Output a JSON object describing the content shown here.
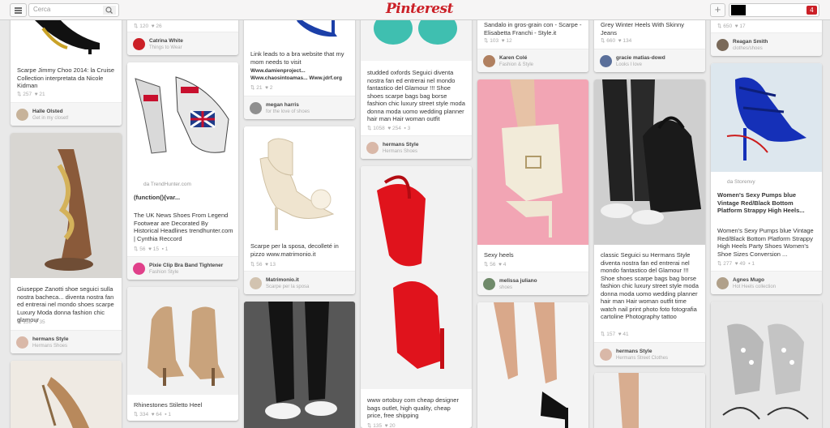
{
  "header": {
    "search_placeholder": "Cerca",
    "logo": "Pinterest",
    "notifications_count": "4",
    "plus_label": "+"
  },
  "pins": {
    "c1p1": {
      "text": "Scarpe Jimmy Choo 2014: la Cruise Collection interpretata da Nicole Kidman",
      "repins": "257",
      "likes": "21",
      "user": "Halle Olsted",
      "board": "Get in my closet!"
    },
    "c1p2": {
      "text": "Giuseppe Zanotti shoe seguici sulla nostra bacheca... diventa nostra fan ed entrerai nel mondo shoes scarpe Luxury Moda donna fashion chic glamour",
      "repins": "158",
      "likes": "35",
      "user": "hermans Style",
      "board": "Hermans Shoes"
    },
    "c2p1": {
      "repins": "120",
      "likes": "26",
      "user": "Catrina White",
      "board": "Things to Wear"
    },
    "c2p2": {
      "source": "da TrendHunter.com",
      "title": "(function(){var...",
      "text": "The UK News Shoes From Legend Footwear are Decorated By Historical Headlines trendhunter.com | Cynthia Reccord",
      "repins": "56",
      "likes": "15",
      "comments": "1",
      "user": "Pixie Clip Bra Band Tightener",
      "board": "Fashion Style"
    },
    "c2p3": {
      "text": "Rhinestones Stiletto Heel",
      "repins": "334",
      "likes": "64",
      "comments": "1"
    },
    "c3p1": {
      "text": "Link leads to a bra website that my mom needs to visit",
      "links": "Www.damienproject... Www.chaosintoamas... Www.jdrf.org",
      "repins": "21",
      "likes": "2",
      "user": "megan harris",
      "board": "for the love of shoes"
    },
    "c3p2": {
      "text": "Scarpe per la sposa, decolleté in pizzo www.matrimonio.it",
      "repins": "56",
      "likes": "13",
      "user": "Matrimonio.it",
      "board": "Scarpe per la sposa"
    },
    "c4p1": {
      "text": "studded oxfords Seguici diventa nostra fan ed entrerai nel mondo fantastico del Glamour !!! Shoe shoes scarpe bags bag borse fashion chic luxury street style moda donna moda uomo wedding planner hair man Hair woman outfit",
      "repins": "1058",
      "likes": "254",
      "comments": "3",
      "user": "hermans Style",
      "board": "Hermans Shoes"
    },
    "c4p2": {
      "text": "www ortobuy com cheap designer bags outlet, high quality, cheap price, free shipping",
      "repins": "135",
      "likes": "20"
    },
    "c5p1": {
      "text": "Sandalo in gros-grain con - Scarpe - Elisabetta Franchi - Style.it",
      "repins": "103",
      "likes": "12",
      "user": "Karen Colé",
      "board": "Fashion & Style"
    },
    "c5p2": {
      "text": "Sexy heels",
      "repins": "56",
      "likes": "4",
      "user": "melissa juliano",
      "board": "shoes"
    },
    "c6p1": {
      "text": "Grey Winter Heels With Skinny Jeans",
      "repins": "660",
      "likes": "134",
      "user": "gracie matias-dowd",
      "board": "Looks I love"
    },
    "c6p2": {
      "text": "classic Seguici su Hermans Style diventa nostra fan ed entrerai nel mondo fantastico del Glamour !!! Shoe shoes scarpe bags bag borse fashion chic luxury street style moda donna moda uomo wedding planner hair man Hair woman outfit time watch nail print photo foto fotografia cartoline Photography tattoo",
      "repins": "157",
      "likes": "41",
      "user": "hermans Style",
      "board": "Hermans Street Clothes"
    },
    "c7p1": {
      "repins": "650",
      "likes": "17",
      "user": "Reagan Smith",
      "board": "clothes/shoes"
    },
    "c7p2": {
      "source": "da Storenvy",
      "title": "Women's Sexy Pumps blue Vintage Red/Black Bottom Platform Strappy High Heels...",
      "text": "Women's Sexy Pumps blue Vintage Red/Black Bottom Platform Strappy High Heels Party Shoes Women's Shoe Sizes Conversion ...",
      "repins": "277",
      "likes": "49",
      "comments": "1",
      "user": "Agnes Mugo",
      "board": "Hot Heels collection"
    }
  }
}
